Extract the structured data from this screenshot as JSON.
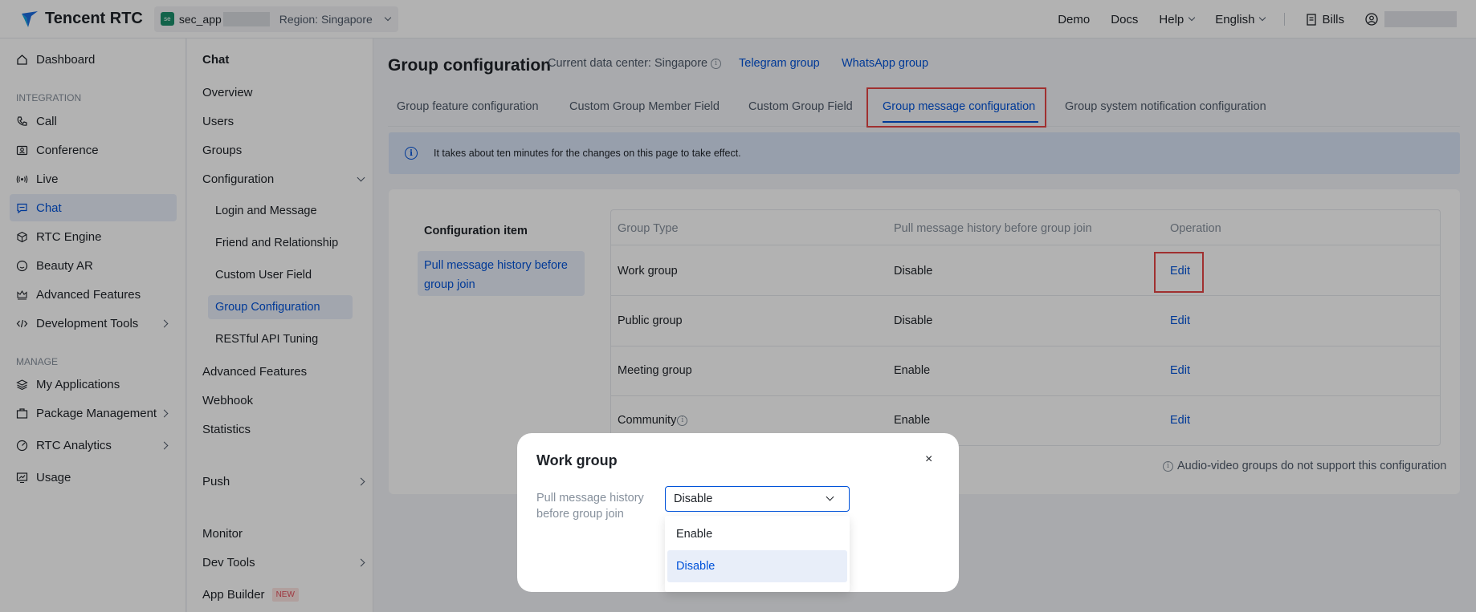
{
  "topbar": {
    "brand": "Tencent RTC",
    "app_badge": "se",
    "app_name": "sec_app",
    "region": "Region: Singapore",
    "links": [
      "Demo",
      "Docs",
      "Help",
      "English"
    ],
    "bills": "Bills"
  },
  "leftnav": {
    "dashboard": "Dashboard",
    "section_integration": "INTEGRATION",
    "call": "Call",
    "conference": "Conference",
    "live": "Live",
    "chat": "Chat",
    "rtc_engine": "RTC Engine",
    "beauty_ar": "Beauty AR",
    "advanced_features": "Advanced Features",
    "development_tools": "Development Tools",
    "section_manage": "MANAGE",
    "my_applications": "My Applications",
    "package_management": "Package Management",
    "rtc_analytics": "RTC Analytics",
    "usage": "Usage"
  },
  "subnav": {
    "title": "Chat",
    "overview": "Overview",
    "users": "Users",
    "groups": "Groups",
    "configuration": "Configuration",
    "login_message": "Login and Message",
    "friend_relationship": "Friend and Relationship",
    "custom_user_field": "Custom User Field",
    "group_configuration": "Group Configuration",
    "restful_api": "RESTful API Tuning",
    "advanced_features": "Advanced Features",
    "webhook": "Webhook",
    "statistics": "Statistics",
    "push": "Push",
    "monitor": "Monitor",
    "dev_tools": "Dev Tools",
    "app_builder": "App Builder",
    "new_badge": "NEW"
  },
  "main": {
    "title": "Group configuration",
    "data_center": "Current data center: Singapore",
    "telegram": "Telegram group",
    "whatsapp": "WhatsApp group",
    "tabs": [
      "Group feature configuration",
      "Custom Group Member Field",
      "Custom Group Field",
      "Group message configuration",
      "Group system notification configuration"
    ],
    "notice": "It takes about ten minutes for the changes on this page to take effect.",
    "config_item_label": "Configuration item",
    "config_item": "Pull message history before group join",
    "table": {
      "headers": [
        "Group Type",
        "Pull message history before group join",
        "Operation"
      ],
      "rows": [
        {
          "type": "Work group",
          "value": "Disable",
          "op": "Edit"
        },
        {
          "type": "Public group",
          "value": "Disable",
          "op": "Edit"
        },
        {
          "type": "Meeting group",
          "value": "Enable",
          "op": "Edit"
        },
        {
          "type": "Community",
          "value": "Enable",
          "op": "Edit"
        }
      ]
    },
    "note": "Audio-video groups do not support this configuration"
  },
  "modal": {
    "title": "Work group",
    "close": "×",
    "label": "Pull message history before group join",
    "selected": "Disable",
    "options": [
      "Enable",
      "Disable"
    ]
  },
  "colors": {
    "accent": "#0052d9",
    "highlight": "#e54545",
    "brand_badge": "#1a8f6a"
  }
}
